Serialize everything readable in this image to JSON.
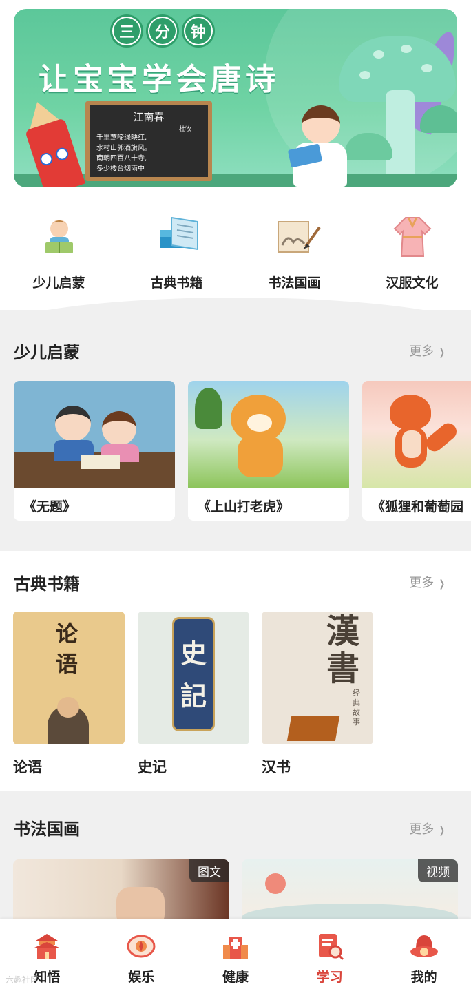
{
  "banner": {
    "pills": [
      "三",
      "分",
      "钟"
    ],
    "title": "让宝宝学会唐诗",
    "poem": {
      "title": "江南春",
      "author": "杜牧",
      "lines": [
        "千里莺啼绿映红,",
        "水村山郭酒旗风。",
        "南朝四百八十寺,",
        "多少楼台烟雨中"
      ]
    }
  },
  "categories": [
    {
      "label": "少儿启蒙",
      "icon": "child-reading-icon"
    },
    {
      "label": "古典书籍",
      "icon": "classic-books-icon"
    },
    {
      "label": "书法国画",
      "icon": "calligraphy-scroll-icon"
    },
    {
      "label": "汉服文化",
      "icon": "hanfu-robe-icon"
    }
  ],
  "sections": {
    "enlightenment": {
      "title": "少儿启蒙",
      "more": "更多",
      "cards": [
        {
          "caption": "《无题》"
        },
        {
          "caption": "《上山打老虎》"
        },
        {
          "caption": "《狐狸和葡萄园"
        }
      ]
    },
    "classics": {
      "title": "古典书籍",
      "more": "更多",
      "books": [
        {
          "name": "论语",
          "cover_text": [
            "论",
            "语"
          ]
        },
        {
          "name": "史记",
          "cover_text": [
            "史",
            "記"
          ]
        },
        {
          "name": "汉书",
          "cover_text": [
            "漢",
            "書"
          ],
          "cover_sub": "经典故事"
        }
      ]
    },
    "painting": {
      "title": "书法国画",
      "more": "更多",
      "cards": [
        {
          "badge": "图文"
        },
        {
          "badge": "视频"
        }
      ]
    }
  },
  "nav": [
    {
      "label": "知悟",
      "icon": "temple-icon",
      "active": false
    },
    {
      "label": "娱乐",
      "icon": "compass-icon",
      "active": false
    },
    {
      "label": "健康",
      "icon": "hospital-icon",
      "active": false
    },
    {
      "label": "学习",
      "icon": "study-document-icon",
      "active": true
    },
    {
      "label": "我的",
      "icon": "profile-hat-icon",
      "active": false
    }
  ],
  "watermark": "六趣社区"
}
